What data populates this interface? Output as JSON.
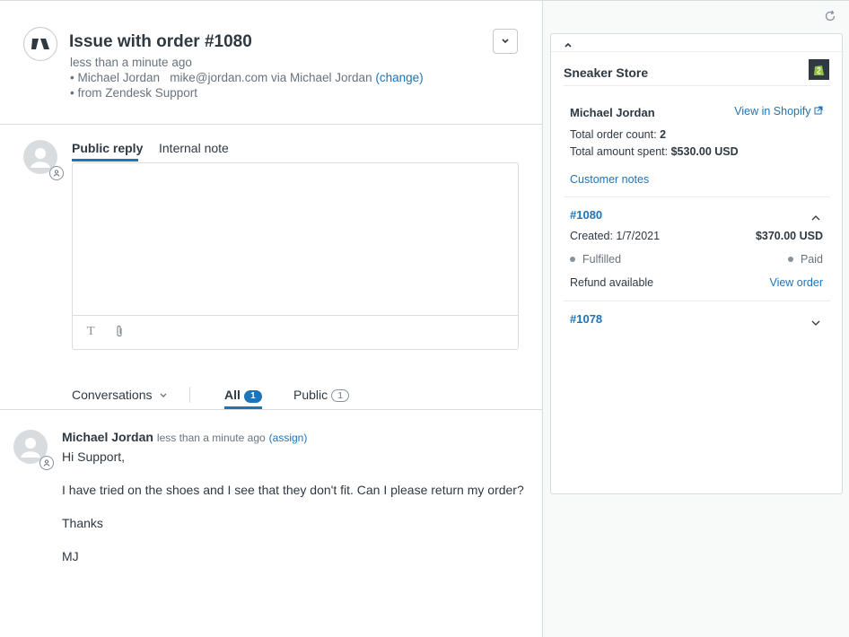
{
  "ticket": {
    "title": "Issue with order #1080",
    "time": "less than a minute ago",
    "requester_line_prefix": "• Michael Jordan   mike@jordan.com via Michael Jordan",
    "change_link": "(change)",
    "source_line": "• from Zendesk Support"
  },
  "reply": {
    "tabs": [
      "Public reply",
      "Internal note"
    ],
    "active_tab": "Public reply",
    "body_value": ""
  },
  "filters": {
    "conversations_label": "Conversations",
    "all_label": "All",
    "all_count": "1",
    "public_label": "Public",
    "public_count": "1"
  },
  "conversation": [
    {
      "author": "Michael Jordan",
      "time": "less than a minute ago",
      "assign": "(assign)",
      "lines": [
        "Hi Support,",
        "I have tried on the shoes and I see that they don't fit. Can I please return my order?",
        "Thanks",
        "MJ"
      ]
    }
  ],
  "sidebar": {
    "store_name": "Sneaker Store",
    "customer_name": "Michael Jordan",
    "view_in_shopify": "View in Shopify",
    "total_order_count_label": "Total order count:",
    "total_order_count": "2",
    "total_amount_label": "Total amount spent:",
    "total_amount": "$530.00 USD",
    "customer_notes": "Customer notes",
    "orders": [
      {
        "number": "#1080",
        "created_label": "Created: 1/7/2021",
        "amount": "$370.00 USD",
        "fulfillment": "Fulfilled",
        "payment": "Paid",
        "refund": "Refund available",
        "view_order": "View order",
        "expanded": true
      },
      {
        "number": "#1078",
        "expanded": false
      }
    ]
  },
  "colors": {
    "accent": "#1f73b7",
    "text": "#2f3941",
    "muted": "#68737d",
    "border": "#d8dcde",
    "shopify_green": "#95bf47"
  }
}
